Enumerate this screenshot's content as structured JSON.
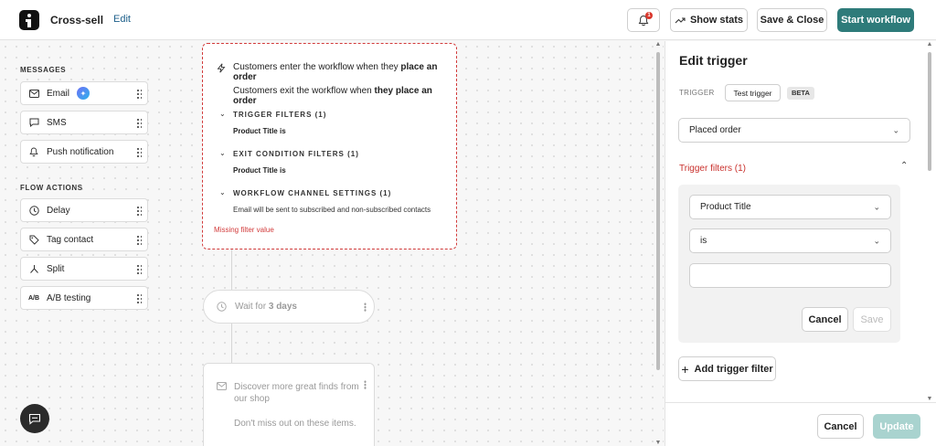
{
  "header": {
    "title": "Cross-sell",
    "edit_label": "Edit",
    "notification_count": "1",
    "show_stats_label": "Show stats",
    "save_close_label": "Save & Close",
    "start_workflow_label": "Start workflow"
  },
  "palette": {
    "messages_heading": "MESSAGES",
    "messages": [
      {
        "label": "Email",
        "icon": "mail-icon"
      },
      {
        "label": "SMS",
        "icon": "chat-icon"
      },
      {
        "label": "Push notification",
        "icon": "bell-icon"
      }
    ],
    "flow_heading": "FLOW ACTIONS",
    "flow_actions": [
      {
        "label": "Delay",
        "icon": "clock-icon"
      },
      {
        "label": "Tag contact",
        "icon": "tag-icon"
      },
      {
        "label": "Split",
        "icon": "split-icon"
      },
      {
        "label": "A/B testing",
        "icon": "ab-icon",
        "icon_text": "A/B"
      }
    ]
  },
  "trigger_card": {
    "enter_prefix": "Customers enter the workflow when they ",
    "enter_bold": "place an order",
    "exit_prefix": "Customers exit the workflow when ",
    "exit_bold": "they place an order",
    "trigger_filters_heading": "TRIGGER FILTERS (1)",
    "trigger_filter_value": "Product Title  is",
    "exit_filters_heading": "EXIT CONDITION FILTERS (1)",
    "exit_filter_value": "Product Title  is",
    "channel_heading": "WORKFLOW CHANNEL SETTINGS (1)",
    "channel_note": "Email will be sent to subscribed and non-subscribed contacts",
    "missing_note": "Missing filter value"
  },
  "wait_card": {
    "prefix": "Wait for ",
    "bold": "3 days"
  },
  "email_card": {
    "subject": "Discover more great finds from our shop",
    "preview": "Don't miss out on these items."
  },
  "panel": {
    "title": "Edit trigger",
    "trigger_label": "TRIGGER",
    "test_trigger_label": "Test trigger",
    "beta_label": "BETA",
    "trigger_select_value": "Placed order",
    "filters_title": "Trigger filters (1)",
    "filter_field_value": "Product Title",
    "filter_operator_value": "is",
    "filter_value": "",
    "cancel_label": "Cancel",
    "save_label": "Save",
    "add_filter_label": "Add trigger filter",
    "footer_cancel_label": "Cancel",
    "update_label": "Update"
  },
  "colors": {
    "accent": "#2e7b7a",
    "error": "#d23b3b",
    "update_disabled": "#a9d3cf"
  }
}
